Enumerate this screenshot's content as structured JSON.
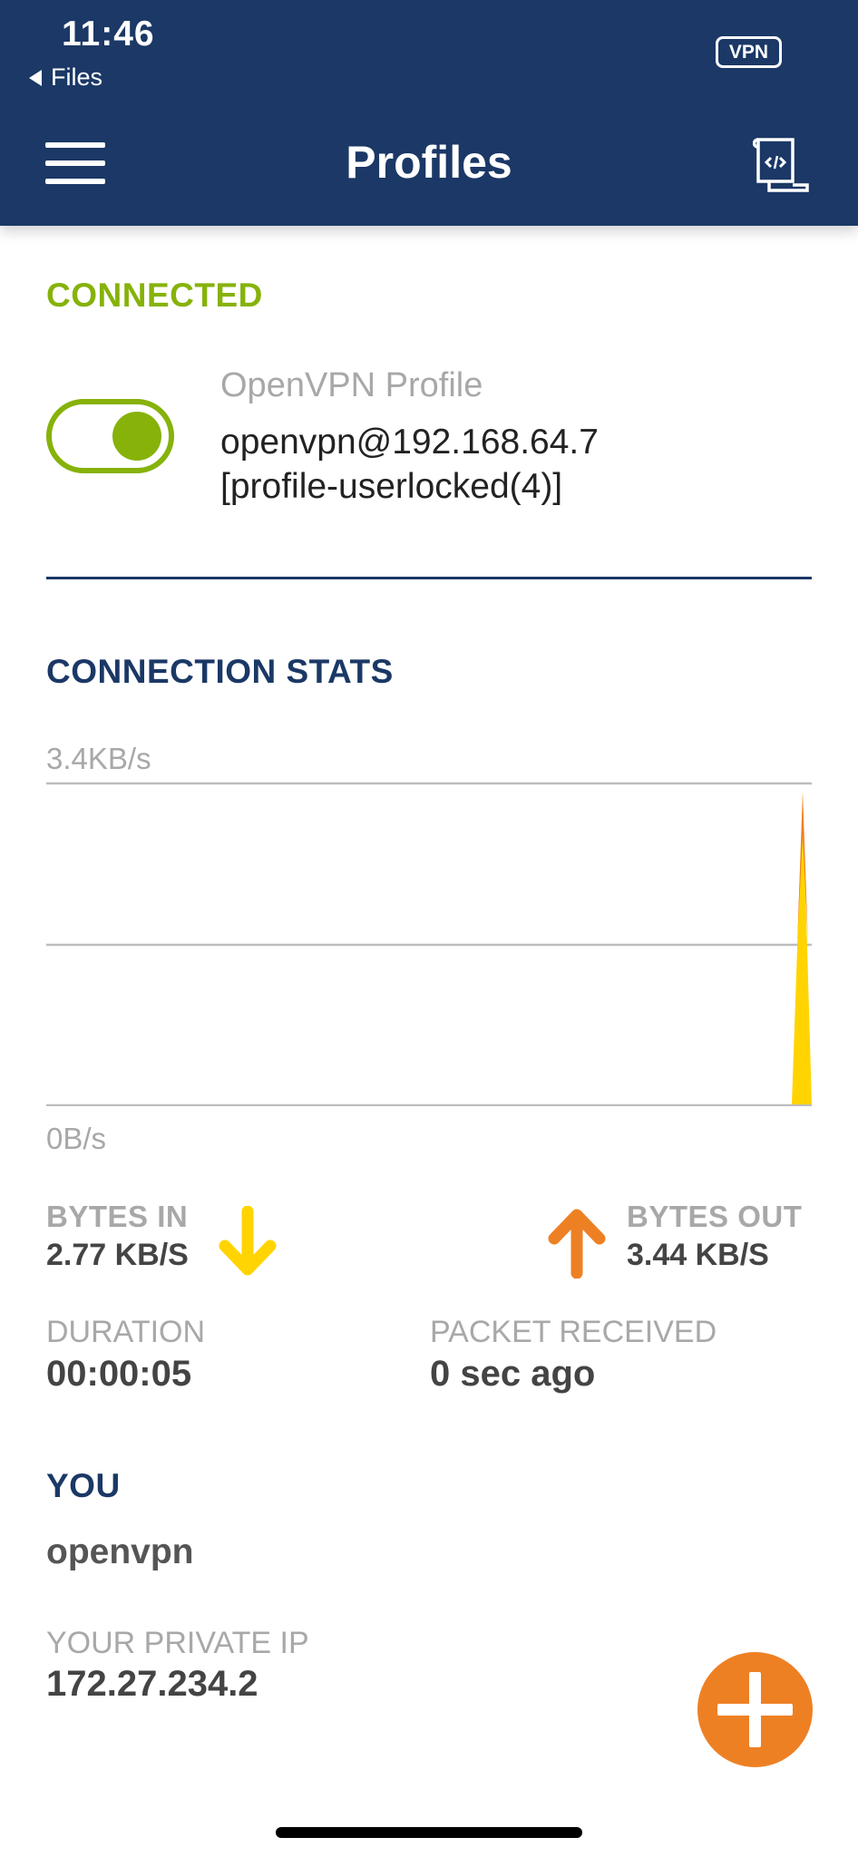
{
  "status_bar": {
    "time": "11:46",
    "back_label": "Files",
    "vpn_badge": "VPN"
  },
  "header": {
    "title": "Profiles",
    "menu_icon": "hamburger-menu-icon",
    "log_icon": "log-scroll-icon",
    "background": "#1b3866"
  },
  "connection": {
    "status": "CONNECTED",
    "status_color": "#86b20a",
    "toggle_on": true,
    "profile_name": "OpenVPN Profile",
    "profile_host": "openvpn@192.168.64.7",
    "profile_tag": "[profile-userlocked(4)]"
  },
  "stats": {
    "title": "CONNECTION STATS",
    "chart_max_label": "3.4KB/s",
    "chart_min_label": "0B/s",
    "bytes_in_label": "BYTES IN",
    "bytes_in_value": "2.77 KB/S",
    "bytes_out_label": "BYTES OUT",
    "bytes_out_value": "3.44 KB/S",
    "duration_label": "DURATION",
    "duration_value": "00:00:05",
    "packet_label": "PACKET RECEIVED",
    "packet_value": "0 sec ago",
    "in_color": "#ffd400",
    "out_color": "#ee8024"
  },
  "you": {
    "title": "YOU",
    "username": "openvpn",
    "private_ip_label": "YOUR PRIVATE IP",
    "private_ip": "172.27.234.2"
  },
  "fab": {
    "icon": "plus-icon",
    "color": "#ee8024"
  }
}
